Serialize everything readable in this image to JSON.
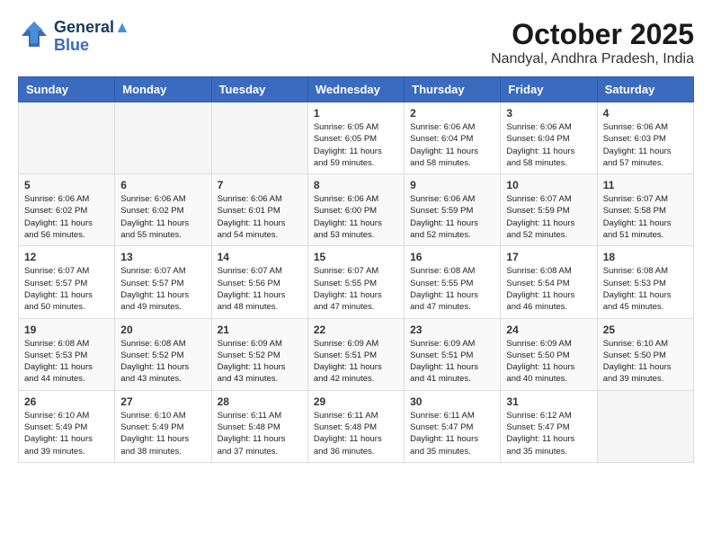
{
  "logo": {
    "line1": "General",
    "line2": "Blue"
  },
  "title": "October 2025",
  "subtitle": "Nandyal, Andhra Pradesh, India",
  "weekdays": [
    "Sunday",
    "Monday",
    "Tuesday",
    "Wednesday",
    "Thursday",
    "Friday",
    "Saturday"
  ],
  "weeks": [
    [
      {
        "day": "",
        "content": ""
      },
      {
        "day": "",
        "content": ""
      },
      {
        "day": "",
        "content": ""
      },
      {
        "day": "1",
        "content": "Sunrise: 6:05 AM\nSunset: 6:05 PM\nDaylight: 11 hours\nand 59 minutes."
      },
      {
        "day": "2",
        "content": "Sunrise: 6:06 AM\nSunset: 6:04 PM\nDaylight: 11 hours\nand 58 minutes."
      },
      {
        "day": "3",
        "content": "Sunrise: 6:06 AM\nSunset: 6:04 PM\nDaylight: 11 hours\nand 58 minutes."
      },
      {
        "day": "4",
        "content": "Sunrise: 6:06 AM\nSunset: 6:03 PM\nDaylight: 11 hours\nand 57 minutes."
      }
    ],
    [
      {
        "day": "5",
        "content": "Sunrise: 6:06 AM\nSunset: 6:02 PM\nDaylight: 11 hours\nand 56 minutes."
      },
      {
        "day": "6",
        "content": "Sunrise: 6:06 AM\nSunset: 6:02 PM\nDaylight: 11 hours\nand 55 minutes."
      },
      {
        "day": "7",
        "content": "Sunrise: 6:06 AM\nSunset: 6:01 PM\nDaylight: 11 hours\nand 54 minutes."
      },
      {
        "day": "8",
        "content": "Sunrise: 6:06 AM\nSunset: 6:00 PM\nDaylight: 11 hours\nand 53 minutes."
      },
      {
        "day": "9",
        "content": "Sunrise: 6:06 AM\nSunset: 5:59 PM\nDaylight: 11 hours\nand 52 minutes."
      },
      {
        "day": "10",
        "content": "Sunrise: 6:07 AM\nSunset: 5:59 PM\nDaylight: 11 hours\nand 52 minutes."
      },
      {
        "day": "11",
        "content": "Sunrise: 6:07 AM\nSunset: 5:58 PM\nDaylight: 11 hours\nand 51 minutes."
      }
    ],
    [
      {
        "day": "12",
        "content": "Sunrise: 6:07 AM\nSunset: 5:57 PM\nDaylight: 11 hours\nand 50 minutes."
      },
      {
        "day": "13",
        "content": "Sunrise: 6:07 AM\nSunset: 5:57 PM\nDaylight: 11 hours\nand 49 minutes."
      },
      {
        "day": "14",
        "content": "Sunrise: 6:07 AM\nSunset: 5:56 PM\nDaylight: 11 hours\nand 48 minutes."
      },
      {
        "day": "15",
        "content": "Sunrise: 6:07 AM\nSunset: 5:55 PM\nDaylight: 11 hours\nand 47 minutes."
      },
      {
        "day": "16",
        "content": "Sunrise: 6:08 AM\nSunset: 5:55 PM\nDaylight: 11 hours\nand 47 minutes."
      },
      {
        "day": "17",
        "content": "Sunrise: 6:08 AM\nSunset: 5:54 PM\nDaylight: 11 hours\nand 46 minutes."
      },
      {
        "day": "18",
        "content": "Sunrise: 6:08 AM\nSunset: 5:53 PM\nDaylight: 11 hours\nand 45 minutes."
      }
    ],
    [
      {
        "day": "19",
        "content": "Sunrise: 6:08 AM\nSunset: 5:53 PM\nDaylight: 11 hours\nand 44 minutes."
      },
      {
        "day": "20",
        "content": "Sunrise: 6:08 AM\nSunset: 5:52 PM\nDaylight: 11 hours\nand 43 minutes."
      },
      {
        "day": "21",
        "content": "Sunrise: 6:09 AM\nSunset: 5:52 PM\nDaylight: 11 hours\nand 43 minutes."
      },
      {
        "day": "22",
        "content": "Sunrise: 6:09 AM\nSunset: 5:51 PM\nDaylight: 11 hours\nand 42 minutes."
      },
      {
        "day": "23",
        "content": "Sunrise: 6:09 AM\nSunset: 5:51 PM\nDaylight: 11 hours\nand 41 minutes."
      },
      {
        "day": "24",
        "content": "Sunrise: 6:09 AM\nSunset: 5:50 PM\nDaylight: 11 hours\nand 40 minutes."
      },
      {
        "day": "25",
        "content": "Sunrise: 6:10 AM\nSunset: 5:50 PM\nDaylight: 11 hours\nand 39 minutes."
      }
    ],
    [
      {
        "day": "26",
        "content": "Sunrise: 6:10 AM\nSunset: 5:49 PM\nDaylight: 11 hours\nand 39 minutes."
      },
      {
        "day": "27",
        "content": "Sunrise: 6:10 AM\nSunset: 5:49 PM\nDaylight: 11 hours\nand 38 minutes."
      },
      {
        "day": "28",
        "content": "Sunrise: 6:11 AM\nSunset: 5:48 PM\nDaylight: 11 hours\nand 37 minutes."
      },
      {
        "day": "29",
        "content": "Sunrise: 6:11 AM\nSunset: 5:48 PM\nDaylight: 11 hours\nand 36 minutes."
      },
      {
        "day": "30",
        "content": "Sunrise: 6:11 AM\nSunset: 5:47 PM\nDaylight: 11 hours\nand 35 minutes."
      },
      {
        "day": "31",
        "content": "Sunrise: 6:12 AM\nSunset: 5:47 PM\nDaylight: 11 hours\nand 35 minutes."
      },
      {
        "day": "",
        "content": ""
      }
    ]
  ]
}
